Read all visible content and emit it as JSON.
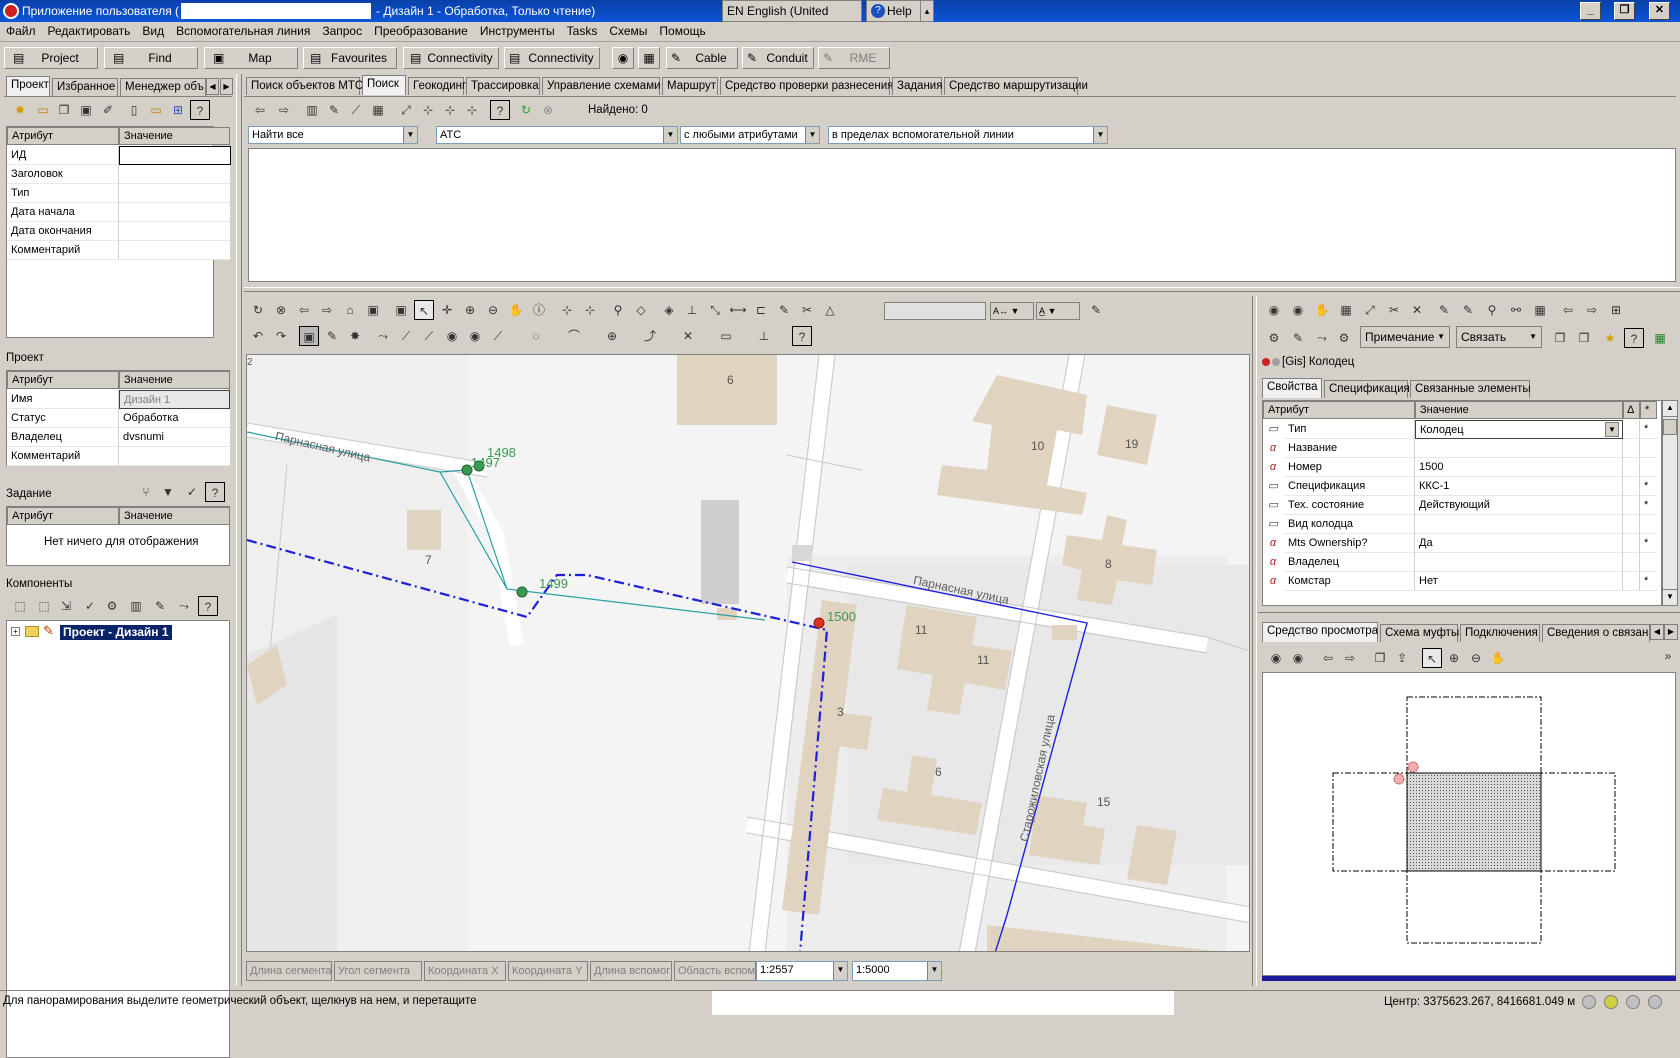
{
  "window": {
    "title_prefix": "Приложение пользователя (",
    "title_suffix": "- Дизайн 1 - Обработка, Только чтение)",
    "language": "EN English (United States)",
    "help": "Help"
  },
  "menu": [
    "Файл",
    "Редактировать",
    "Вид",
    "Вспомогательная линия",
    "Запрос",
    "Преобразование",
    "Инструменты",
    "Tasks",
    "Схемы",
    "Помощь"
  ],
  "toolbar": {
    "project": "Project",
    "find": "Find",
    "map": "Map",
    "favourites": "Favourites",
    "connectivity1": "Connectivity",
    "connectivity2": "Connectivity",
    "cable": "Cable",
    "conduit": "Conduit",
    "rme": "RME"
  },
  "left_tabs": [
    "Проект",
    "Избранное",
    "Менеджер объ"
  ],
  "attr_table": {
    "header_attr": "Атрибут",
    "header_val": "Значение",
    "rows": [
      "ИД",
      "Заголовок",
      "Тип",
      "Дата начала",
      "Дата окончания",
      "Комментарий"
    ]
  },
  "project_section": {
    "title": "Проект",
    "header_attr": "Атрибут",
    "header_val": "Значение",
    "rows": [
      {
        "attr": "Имя",
        "val": "Дизайн 1"
      },
      {
        "attr": "Статус",
        "val": "Обработка"
      },
      {
        "attr": "Владелец",
        "val": "dvsnumi"
      },
      {
        "attr": "Комментарий",
        "val": ""
      }
    ]
  },
  "task_section": {
    "title": "Задание",
    "header_attr": "Атрибут",
    "header_val": "Значение",
    "empty": "Нет ничего для отображения"
  },
  "components_section": {
    "title": "Компоненты",
    "tree_item": "Проект - Дизайн 1"
  },
  "search_tabs": [
    "Поиск объектов МТС",
    "Поиск",
    "Геокодинг",
    "Трассировка",
    "Управление схемами",
    "Маршрут",
    "Средство проверки разнесения",
    "Задания",
    "Средство маршрутизации"
  ],
  "search": {
    "found": "Найдено: 0",
    "combo1": "Найти все",
    "combo2": "АТС",
    "combo3": "с любыми атрибутами",
    "combo4": "в пределах вспомогательной линии"
  },
  "map": {
    "streets": [
      "Парнасная улица",
      "Парнасная улица",
      "Старожиловская улица"
    ],
    "buildings": [
      "6",
      "10",
      "19",
      "7",
      "8",
      "11",
      "11",
      "3",
      "6",
      "15",
      "2"
    ],
    "nodes": [
      "1497",
      "1498",
      "1499",
      "1500"
    ]
  },
  "map_status": {
    "fields": [
      "Длина сегмента",
      "Угол сегмента",
      "Координата X",
      "Координата Y",
      "Длина вспомог",
      "Область вспом"
    ],
    "scale1": "1:2557",
    "scale2": "1:5000"
  },
  "right_panel": {
    "note_btn": "Примечание",
    "link_btn": "Связать",
    "object_title": "[Gis] Колодец",
    "tabs": [
      "Свойства",
      "Спецификация",
      "Связанные элементы"
    ],
    "header_attr": "Атрибут",
    "header_val": "Значение",
    "rows": [
      {
        "attr": "Тип",
        "val": "Колодец",
        "star": "*"
      },
      {
        "attr": "Название",
        "val": "",
        "star": ""
      },
      {
        "attr": "Номер",
        "val": "1500",
        "star": ""
      },
      {
        "attr": "Спецификация",
        "val": "ККС-1",
        "star": "*"
      },
      {
        "attr": "Тех. состояние",
        "val": "Действующий",
        "star": "*"
      },
      {
        "attr": "Вид колодца",
        "val": "",
        "star": ""
      },
      {
        "attr": "Mts Ownership?",
        "val": "Да",
        "star": "*"
      },
      {
        "attr": "Владелец",
        "val": "",
        "star": ""
      },
      {
        "attr": "Комстар",
        "val": "Нет",
        "star": "*"
      }
    ],
    "bottom_tabs": [
      "Средство просмотра",
      "Схема муфты",
      "Подключения",
      "Сведения о связан"
    ]
  },
  "statusbar": {
    "hint": "Для панорамирования выделите геометрический объект, щелкнув на нем, и перетащите",
    "center": "Центр: 3375623.267, 8416681.049 м"
  },
  "colors": {
    "title_blue": "#0b56d8",
    "selection": "#0a246a",
    "map_bg": "#f4f4f4",
    "building": "#e0d3c0",
    "route_blue": "#1f1fd6",
    "node_green": "#3a9a50"
  }
}
